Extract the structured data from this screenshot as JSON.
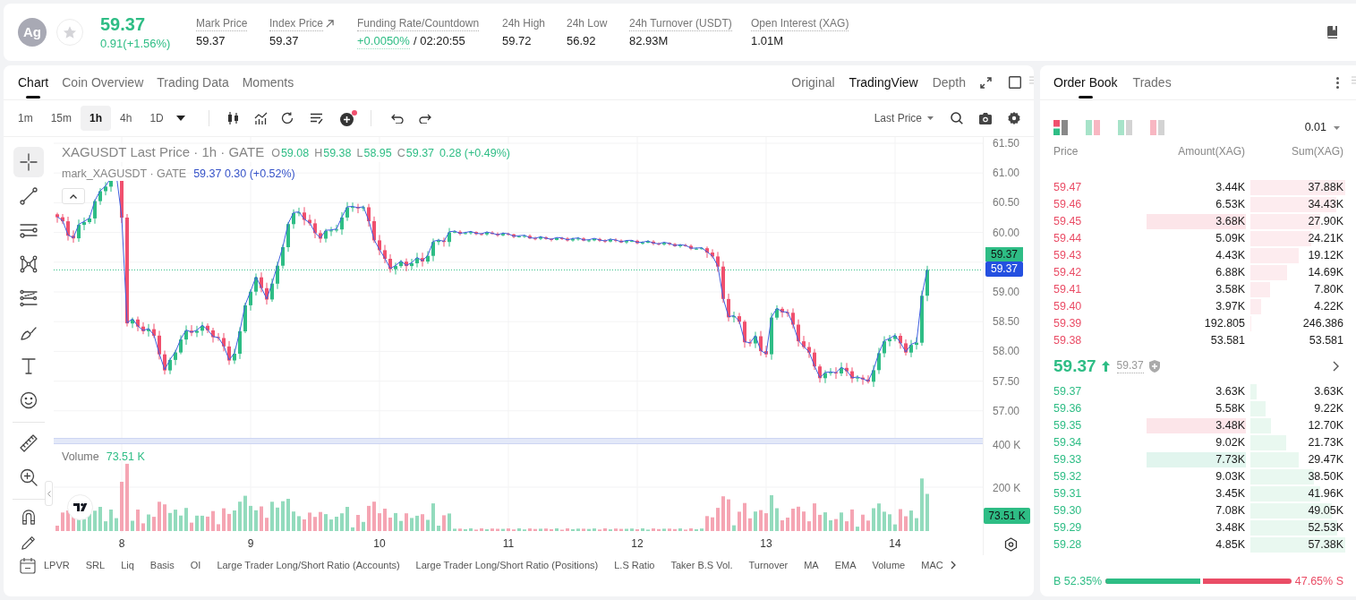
{
  "header": {
    "coin_logo": "Ag",
    "favorited": false,
    "last_price": "59.37",
    "change": "0.91(+1.56%)",
    "stats": [
      {
        "kind": "plain",
        "label": "Mark Price",
        "value": "59.37",
        "underlined": true
      },
      {
        "kind": "link",
        "label": "Index Price",
        "value": "59.37",
        "underlined": true
      },
      {
        "kind": "funding",
        "label": "Funding Rate/Countdown",
        "rate": "+0.0050%",
        "countdown": "/ 02:20:55",
        "underlined": true
      },
      {
        "kind": "plain",
        "label": "24h High",
        "value": "59.72",
        "underlined": false
      },
      {
        "kind": "plain",
        "label": "24h Low",
        "value": "56.92",
        "underlined": false
      },
      {
        "kind": "plain",
        "label": "24h Turnover (USDT)",
        "value": "82.93M",
        "underlined": true
      },
      {
        "kind": "plain",
        "label": "Open Interest (XAG)",
        "value": "1.01M",
        "underlined": true
      }
    ]
  },
  "chart_panel": {
    "tabs": [
      {
        "label": "Chart",
        "selected": true
      },
      {
        "label": "Coin Overview",
        "selected": false
      },
      {
        "label": "Trading Data",
        "selected": false
      },
      {
        "label": "Moments",
        "selected": false
      }
    ],
    "view_modes": [
      {
        "label": "Original",
        "selected": false
      },
      {
        "label": "TradingView",
        "selected": true
      },
      {
        "label": "Depth",
        "selected": false
      }
    ],
    "intervals": [
      {
        "label": "1m",
        "selected": false
      },
      {
        "label": "15m",
        "selected": false
      },
      {
        "label": "1h",
        "selected": true
      },
      {
        "label": "4h",
        "selected": false
      },
      {
        "label": "1D",
        "selected": false
      }
    ],
    "indicator_alert": true,
    "price_source": "Last Price",
    "drawing_tool_groups": [
      [
        {
          "kind": "crosshair",
          "selected": true
        },
        {
          "kind": "trend_line",
          "selected": false
        },
        {
          "kind": "horizontal_lines",
          "selected": false
        },
        {
          "kind": "pattern",
          "selected": false
        },
        {
          "kind": "fibonacci",
          "selected": false
        },
        {
          "kind": "brush",
          "selected": false
        },
        {
          "kind": "text",
          "selected": false
        },
        {
          "kind": "emoji",
          "selected": false
        }
      ],
      [
        {
          "kind": "ruler",
          "selected": false
        },
        {
          "kind": "zoom",
          "selected": false
        }
      ],
      [
        {
          "kind": "magnet",
          "selected": false
        },
        {
          "kind": "pencil",
          "selected": false
        }
      ]
    ],
    "legend": {
      "title": "XAGUSDT Last Price · 1h · GATE",
      "ohlc": [
        {
          "key": "O",
          "value": "59.08"
        },
        {
          "key": "H",
          "value": "59.38"
        },
        {
          "key": "L",
          "value": "58.95"
        },
        {
          "key": "C",
          "value": "59.37"
        }
      ],
      "change": "0.28 (+0.49%)",
      "mark_title": "mark_XAGUSDT · GATE",
      "mark_values": "59.37 0.30 (+0.52%)"
    },
    "price_axis": {
      "ticks": [
        "61.50",
        "61.00",
        "60.50",
        "60.00",
        "59.00",
        "58.50",
        "58.00",
        "57.50",
        "57.00"
      ],
      "last_price_tag": "59.37",
      "mark_price_tag": "59.37"
    },
    "volume": {
      "title": "Volume",
      "value": "73.51 K",
      "ticks": [
        "400 K",
        "200 K"
      ],
      "tag": "73.51 K"
    },
    "time_axis": [
      "8",
      "9",
      "10",
      "11",
      "12",
      "13",
      "14"
    ],
    "indicators": [
      "LPVR",
      "SRL",
      "Liq",
      "Basis",
      "OI",
      "Large Trader Long/Short Ratio (Accounts)",
      "Large Trader Long/Short Ratio (Positions)",
      "L.S Ratio",
      "Taker B.S Vol.",
      "Turnover",
      "MA",
      "EMA",
      "Volume",
      "MAC"
    ]
  },
  "order_book": {
    "tabs": [
      {
        "label": "Order Book",
        "selected": true
      },
      {
        "label": "Trades",
        "selected": false
      }
    ],
    "layouts": [
      {
        "kind": "combined",
        "selected": true
      },
      {
        "kind": "split",
        "selected": false
      },
      {
        "kind": "bids",
        "selected": false
      },
      {
        "kind": "asks",
        "selected": false
      }
    ],
    "precision": "0.01",
    "columns": [
      "Price",
      "Amount(XAG)",
      "Sum(XAG)"
    ],
    "asks": [
      {
        "price": "59.47",
        "amount": "3.44K",
        "sum": "37.88K",
        "highlighted": false
      },
      {
        "price": "59.46",
        "amount": "6.53K",
        "sum": "34.43K",
        "highlighted": false
      },
      {
        "price": "59.45",
        "amount": "3.68K",
        "sum": "27.90K",
        "highlighted": true,
        "color": "#fce5e9"
      },
      {
        "price": "59.44",
        "amount": "5.09K",
        "sum": "24.21K",
        "highlighted": false
      },
      {
        "price": "59.43",
        "amount": "4.43K",
        "sum": "19.12K",
        "highlighted": false
      },
      {
        "price": "59.42",
        "amount": "6.88K",
        "sum": "14.69K",
        "highlighted": false
      },
      {
        "price": "59.41",
        "amount": "3.58K",
        "sum": "7.80K",
        "highlighted": false
      },
      {
        "price": "59.40",
        "amount": "3.97K",
        "sum": "4.22K",
        "highlighted": false
      },
      {
        "price": "59.39",
        "amount": "192.805",
        "sum": "246.386",
        "highlighted": false
      },
      {
        "price": "59.38",
        "amount": "53.581",
        "sum": "53.581",
        "highlighted": false
      }
    ],
    "mid": {
      "price": "59.37",
      "rising": true,
      "mark": "59.37"
    },
    "bids": [
      {
        "price": "59.37",
        "amount": "3.63K",
        "sum": "3.63K",
        "highlighted": false
      },
      {
        "price": "59.36",
        "amount": "5.58K",
        "sum": "9.22K",
        "highlighted": false
      },
      {
        "price": "59.35",
        "amount": "3.48K",
        "sum": "12.70K",
        "highlighted": true,
        "color": "#fce5e9"
      },
      {
        "price": "59.34",
        "amount": "9.02K",
        "sum": "21.73K",
        "highlighted": false
      },
      {
        "price": "59.33",
        "amount": "7.73K",
        "sum": "29.47K",
        "highlighted": true,
        "color": "#e1f5ee"
      },
      {
        "price": "59.32",
        "amount": "9.03K",
        "sum": "38.50K",
        "highlighted": false
      },
      {
        "price": "59.31",
        "amount": "3.45K",
        "sum": "41.96K",
        "highlighted": false
      },
      {
        "price": "59.30",
        "amount": "7.08K",
        "sum": "49.05K",
        "highlighted": false
      },
      {
        "price": "59.29",
        "amount": "3.48K",
        "sum": "52.53K",
        "highlighted": false
      },
      {
        "price": "59.28",
        "amount": "4.85K",
        "sum": "57.38K",
        "highlighted": false
      }
    ],
    "ratio": {
      "buy": "B 52.35%",
      "sell": "47.65% S",
      "level": 0.5235
    }
  }
}
